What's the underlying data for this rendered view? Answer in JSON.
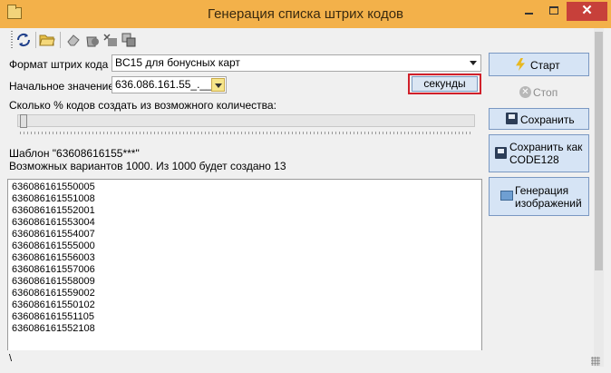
{
  "window": {
    "title": "Генерация списка штрих кодов",
    "close_glyph": "✕"
  },
  "toolbar": {
    "icons": [
      "refresh-icon",
      "open-folder-icon",
      "erase-icon",
      "recycle-icon",
      "clear-icon",
      "copy-icon"
    ]
  },
  "form": {
    "format_label": "Формат штрих кода",
    "format_value": "BC15 для бонусных карт",
    "start_label": "Начальное значение",
    "start_value": "636.086.161.55_.__",
    "seconds_button": "секунды",
    "percent_label": "Сколько % кодов создать из возможного количества:",
    "slider_value": 0
  },
  "info": {
    "template": "Шаблон \"63608616155***\"",
    "variants": "Возможных вариантов 1000. Из 1000 будет создано 13"
  },
  "codes": [
    "636086161550005",
    "636086161551008",
    "636086161552001",
    "636086161553004",
    "636086161554007",
    "636086161555000",
    "636086161556003",
    "636086161557006",
    "636086161558009",
    "636086161559002",
    "636086161550102",
    "636086161551105",
    "636086161552108"
  ],
  "buttons": {
    "start": "Старт",
    "stop": "Стоп",
    "save": "Сохранить",
    "save_as_line1": "Сохранить как",
    "save_as_line2": "CODE128",
    "gen_line1": "Генерация",
    "gen_line2": "изображений"
  },
  "status": {
    "text": "\\"
  },
  "colors": {
    "titlebar": "#f3b14a",
    "close": "#c7403a",
    "button": "#d6e4f5",
    "highlight": "#d0202a"
  }
}
